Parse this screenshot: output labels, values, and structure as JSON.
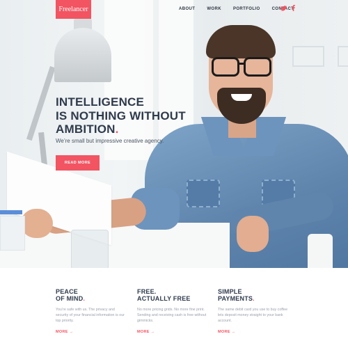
{
  "brand": {
    "logo": "Freelancer",
    "accent": "#f25462",
    "text_dark": "#2f3b4c"
  },
  "nav": {
    "items": [
      {
        "label": "ABOUT"
      },
      {
        "label": "WORK"
      },
      {
        "label": "PORTFOLIO"
      },
      {
        "label": "CONTACT"
      }
    ],
    "social": [
      "twitter-icon",
      "facebook-icon"
    ]
  },
  "hero": {
    "headline": [
      "INTELLIGENCE",
      "IS NOTHING WITHOUT",
      "AMBITION"
    ],
    "headline_dot": ".",
    "tagline": "We’re small but impressive creative agency.",
    "cta": "READ MORE"
  },
  "features": [
    {
      "title_1": "PEACE",
      "title_2": "OF MIND",
      "dot": ".",
      "body": "You’re safe with us. The privacy and security of your financial information is our top priority.",
      "more": "MORE →"
    },
    {
      "title_1": "FREE.",
      "title_2": "ACTUALLY FREE",
      "dot": "",
      "body": "No more pricing grids. No more fine print. Sending and receiving cash is free without gimmicks.",
      "more": "MORE →"
    },
    {
      "title_1": "SIMPLE",
      "title_2": "PAYMENTS",
      "dot": ".",
      "body": "The same debit card you use to buy coffee lets deposit money straight to your bank account.",
      "more": "MORE →"
    }
  ]
}
